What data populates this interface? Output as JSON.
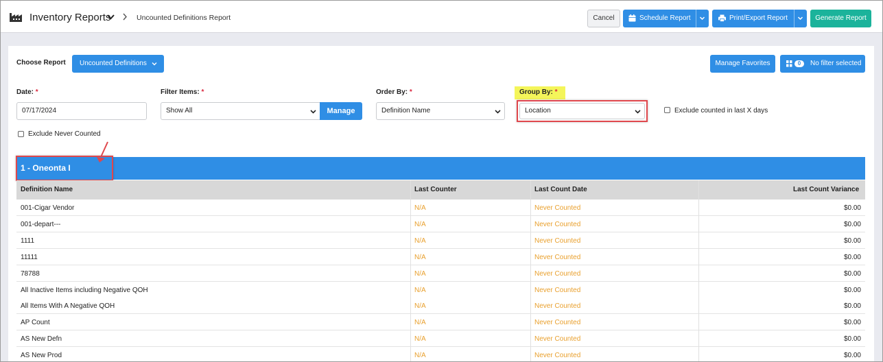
{
  "header": {
    "app_title": "Inventory Reports",
    "breadcrumb": "Uncounted Definitions Report",
    "buttons": {
      "cancel": "Cancel",
      "schedule": "Schedule Report",
      "print_export": "Print/Export Report",
      "generate": "Generate Report"
    }
  },
  "report": {
    "choose_label": "Choose Report",
    "selected": "Uncounted Definitions",
    "manage_favorites": "Manage Favorites",
    "filter_count": "0",
    "filter_label": "No filter selected"
  },
  "filters": {
    "date": {
      "label": "Date:",
      "required": "*",
      "value": "07/17/2024"
    },
    "filter_items": {
      "label": "Filter Items:",
      "required": "*",
      "value": "Show All",
      "manage": "Manage"
    },
    "order_by": {
      "label": "Order By:",
      "required": "*",
      "value": "Definition Name"
    },
    "group_by": {
      "label": "Group By:",
      "required": "*",
      "value": "Location"
    },
    "exclude_counted": "Exclude counted in last X days",
    "exclude_never": "Exclude Never Counted"
  },
  "group": {
    "title": "1 - Oneonta I"
  },
  "table": {
    "columns": [
      "Definition Name",
      "Last Counter",
      "Last Count Date",
      "Last Count Variance"
    ],
    "rows": [
      [
        "001-Cigar Vendor",
        "N/A",
        "Never Counted",
        "$0.00"
      ],
      [
        "001-depart---",
        "N/A",
        "Never Counted",
        "$0.00"
      ],
      [
        "1111",
        "N/A",
        "Never Counted",
        "$0.00"
      ],
      [
        "11111",
        "N/A",
        "Never Counted",
        "$0.00"
      ],
      [
        "78788",
        "N/A",
        "Never Counted",
        "$0.00"
      ],
      [
        "All Inactive Items including Negative QOH",
        "N/A",
        "Never Counted",
        "$0.00"
      ],
      [
        "All Items With A Negative QOH",
        "N/A",
        "Never Counted",
        "$0.00"
      ],
      [
        "AP Count",
        "N/A",
        "Never Counted",
        "$0.00"
      ],
      [
        "AS New Defn",
        "N/A",
        "Never Counted",
        "$0.00"
      ],
      [
        "AS New Prod",
        "N/A",
        "Never Counted",
        "$0.00"
      ]
    ]
  },
  "colors": {
    "primary": "#2f8ee5",
    "teal": "#1bb39b",
    "orange": "#e9a02e",
    "highlight": "#f4f55a",
    "annotation_red": "#e0474c"
  }
}
